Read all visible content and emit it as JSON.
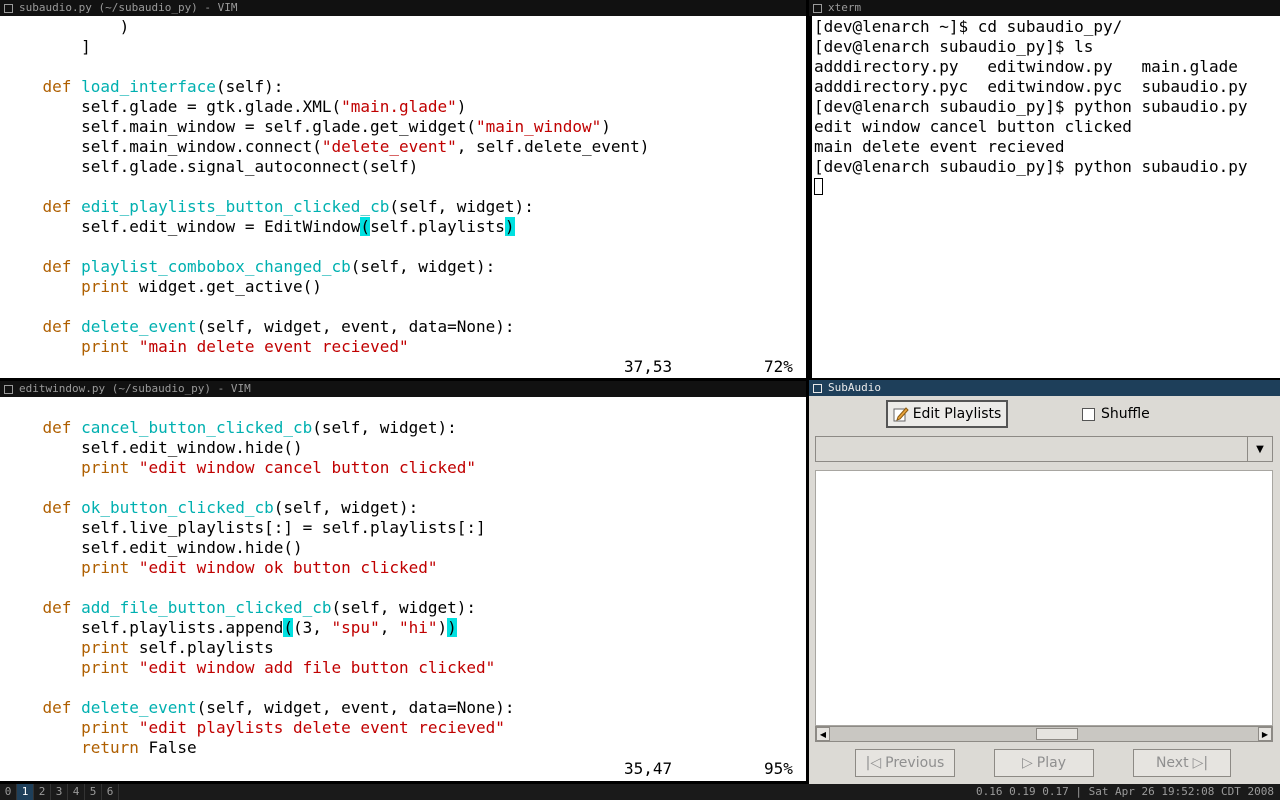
{
  "windows": {
    "vim_top": {
      "title": "subaudio.py (~/subaudio_py) - VIM",
      "cursor_pos": "37,53",
      "percent": "72%"
    },
    "vim_bottom": {
      "title": "editwindow.py (~/subaudio_py) - VIM",
      "cursor_pos": "35,47",
      "percent": "95%"
    },
    "xterm": {
      "title": "xterm",
      "lines": [
        "[dev@lenarch ~]$ cd subaudio_py/",
        "[dev@lenarch subaudio_py]$ ls",
        "adddirectory.py   editwindow.py   main.glade",
        "adddirectory.pyc  editwindow.pyc  subaudio.py",
        "[dev@lenarch subaudio_py]$ python subaudio.py",
        "edit window cancel button clicked",
        "main delete event recieved",
        "[dev@lenarch subaudio_py]$ python subaudio.py"
      ]
    },
    "subaudio": {
      "title": "SubAudio",
      "edit_playlists_label": "Edit Playlists",
      "shuffle_label": "Shuffle",
      "previous_label": "Previous",
      "play_label": "Play",
      "next_label": "Next"
    }
  },
  "code_top": [
    [
      [
        "",
        "            )"
      ]
    ],
    [
      [
        "",
        "        ]"
      ]
    ],
    [],
    [
      [
        "",
        "    "
      ],
      [
        "kw",
        "def"
      ],
      [
        "",
        " "
      ],
      [
        "fn",
        "load_interface"
      ],
      [
        "",
        "(self):"
      ]
    ],
    [
      [
        "",
        "        self.glade = gtk.glade.XML("
      ],
      [
        "st",
        "\"main.glade\""
      ],
      [
        "",
        ")"
      ]
    ],
    [
      [
        "",
        "        self.main_window = self.glade.get_widget("
      ],
      [
        "st",
        "\"main_window\""
      ],
      [
        "",
        ")"
      ]
    ],
    [
      [
        "",
        "        self.main_window.connect("
      ],
      [
        "st",
        "\"delete_event\""
      ],
      [
        "",
        ", self.delete_event)"
      ]
    ],
    [
      [
        "",
        "        self.glade.signal_autoconnect(self)"
      ]
    ],
    [],
    [
      [
        "",
        "    "
      ],
      [
        "kw",
        "def"
      ],
      [
        "",
        " "
      ],
      [
        "fn",
        "edit_playlists_button_clicked_cb"
      ],
      [
        "",
        "(self, widget):"
      ]
    ],
    [
      [
        "",
        "        self.edit_window = EditWindow"
      ],
      [
        "mp",
        "("
      ],
      [
        "",
        "self.playlists"
      ],
      [
        "mp",
        ")"
      ]
    ],
    [],
    [
      [
        "",
        "    "
      ],
      [
        "kw",
        "def"
      ],
      [
        "",
        " "
      ],
      [
        "fn",
        "playlist_combobox_changed_cb"
      ],
      [
        "",
        "(self, widget):"
      ]
    ],
    [
      [
        "",
        "        "
      ],
      [
        "kw",
        "print"
      ],
      [
        "",
        " widget.get_active()"
      ]
    ],
    [],
    [
      [
        "",
        "    "
      ],
      [
        "kw",
        "def"
      ],
      [
        "",
        " "
      ],
      [
        "fn",
        "delete_event"
      ],
      [
        "",
        "(self, widget, event, data=None):"
      ]
    ],
    [
      [
        "",
        "        "
      ],
      [
        "kw",
        "print"
      ],
      [
        "",
        " "
      ],
      [
        "st",
        "\"main delete event recieved\""
      ]
    ]
  ],
  "code_bottom": [
    [],
    [
      [
        "",
        "    "
      ],
      [
        "kw",
        "def"
      ],
      [
        "",
        " "
      ],
      [
        "fn",
        "cancel_button_clicked_cb"
      ],
      [
        "",
        "(self, widget):"
      ]
    ],
    [
      [
        "",
        "        self.edit_window.hide()"
      ]
    ],
    [
      [
        "",
        "        "
      ],
      [
        "kw",
        "print"
      ],
      [
        "",
        " "
      ],
      [
        "st",
        "\"edit window cancel button clicked\""
      ]
    ],
    [],
    [
      [
        "",
        "    "
      ],
      [
        "kw",
        "def"
      ],
      [
        "",
        " "
      ],
      [
        "fn",
        "ok_button_clicked_cb"
      ],
      [
        "",
        "(self, widget):"
      ]
    ],
    [
      [
        "",
        "        self.live_playlists[:] = self.playlists[:]"
      ]
    ],
    [
      [
        "",
        "        self.edit_window.hide()"
      ]
    ],
    [
      [
        "",
        "        "
      ],
      [
        "kw",
        "print"
      ],
      [
        "",
        " "
      ],
      [
        "st",
        "\"edit window ok button clicked\""
      ]
    ],
    [],
    [
      [
        "",
        "    "
      ],
      [
        "kw",
        "def"
      ],
      [
        "",
        " "
      ],
      [
        "fn",
        "add_file_button_clicked_cb"
      ],
      [
        "",
        "(self, widget):"
      ]
    ],
    [
      [
        "",
        "        self.playlists.append"
      ],
      [
        "mp",
        "("
      ],
      [
        "",
        "(3, "
      ],
      [
        "st",
        "\"spu\""
      ],
      [
        "",
        ", "
      ],
      [
        "st",
        "\"hi\""
      ],
      [
        "",
        ")"
      ],
      [
        "mp",
        ")"
      ]
    ],
    [
      [
        "",
        "        "
      ],
      [
        "kw",
        "print"
      ],
      [
        "",
        " self.playlists"
      ]
    ],
    [
      [
        "",
        "        "
      ],
      [
        "kw",
        "print"
      ],
      [
        "",
        " "
      ],
      [
        "st",
        "\"edit window add file button clicked\""
      ]
    ],
    [],
    [
      [
        "",
        "    "
      ],
      [
        "kw",
        "def"
      ],
      [
        "",
        " "
      ],
      [
        "fn",
        "delete_event"
      ],
      [
        "",
        "(self, widget, event, data=None):"
      ]
    ],
    [
      [
        "",
        "        "
      ],
      [
        "kw",
        "print"
      ],
      [
        "",
        " "
      ],
      [
        "st",
        "\"edit playlists delete event recieved\""
      ]
    ],
    [
      [
        "",
        "        "
      ],
      [
        "kw",
        "return"
      ],
      [
        "",
        " False"
      ]
    ]
  ],
  "taskbar": {
    "workspaces": [
      "0",
      "1",
      "2",
      "3",
      "4",
      "5",
      "6"
    ],
    "active_workspace": "1",
    "sysinfo": "0.16 0.19 0.17 | Sat Apr 26 19:52:08 CDT 2008"
  },
  "colors": {
    "keyword": "#af5f00",
    "function": "#00b0b0",
    "string": "#c00000",
    "matchparen": "#00e0e0",
    "active_title": "#1e3f5a"
  }
}
